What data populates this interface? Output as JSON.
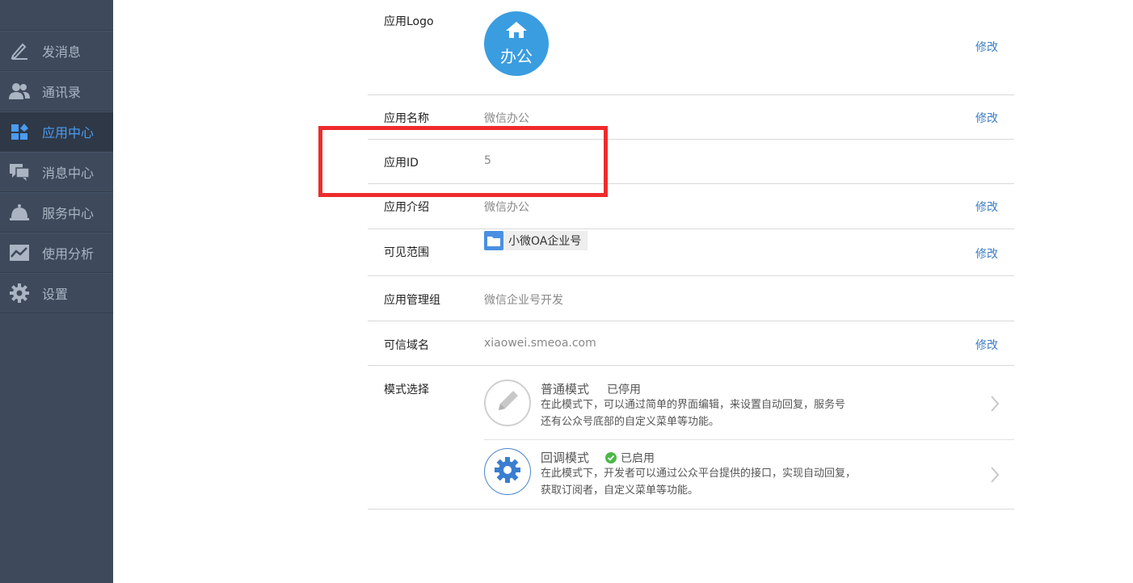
{
  "sidebar": {
    "items": [
      {
        "label": "发消息",
        "icon": "pencil-icon"
      },
      {
        "label": "通讯录",
        "icon": "contacts-icon"
      },
      {
        "label": "应用中心",
        "icon": "apps-icon",
        "active": true
      },
      {
        "label": "消息中心",
        "icon": "chat-icon"
      },
      {
        "label": "服务中心",
        "icon": "bell-icon"
      },
      {
        "label": "使用分析",
        "icon": "chart-icon"
      },
      {
        "label": "设置",
        "icon": "gear-icon"
      }
    ]
  },
  "app": {
    "logo_label": "应用Logo",
    "logo_text": "办公",
    "name_label": "应用名称",
    "name_value": "微信办公",
    "id_label": "应用ID",
    "id_value": "5",
    "intro_label": "应用介绍",
    "intro_value": "微信办公",
    "scope_label": "可见范围",
    "scope_value": "小微OA企业号",
    "admin_label": "应用管理组",
    "admin_value": "微信企业号开发",
    "domain_label": "可信域名",
    "domain_value": "xiaowei.smeoa.com",
    "mode_label": "模式选择",
    "edit_label": "修改"
  },
  "modes": [
    {
      "title": "普通模式",
      "status": "已停用",
      "desc_line1": "在此模式下，可以通过简单的界面编辑，来设置自动回复，服务号",
      "desc_line2": "还有公众号底部的自定义菜单等功能。"
    },
    {
      "title": "回调模式",
      "status": "已启用",
      "desc_line1": "在此模式下，开发者可以通过公众平台提供的接口，实现自动回复，",
      "desc_line2": "获取订阅者，自定义菜单等功能。"
    }
  ],
  "colors": {
    "sidebar_bg": "#3e4a5c",
    "accent": "#4a9cf0",
    "link": "#3b7dc4",
    "highlight": "#ee2b2b",
    "enabled_green": "#4cb848"
  }
}
